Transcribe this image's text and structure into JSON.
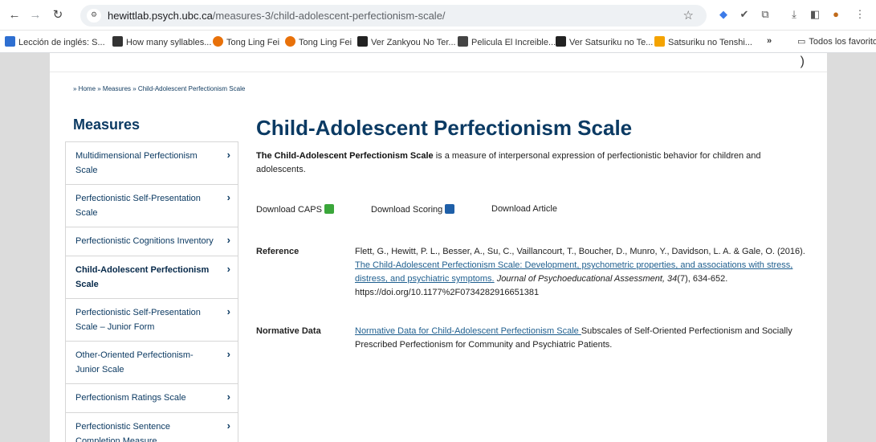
{
  "browser": {
    "url_host": "hewittlab.psych.ubc.ca",
    "url_path": "/measures-3/child-adolescent-perfectionism-scale/",
    "bookmarks": [
      {
        "label": "Lección de inglés: S...",
        "color": "#2e6fd1",
        "icon": "flag-icon"
      },
      {
        "label": "How many syllables...",
        "color": "#333333",
        "icon": "bookmark-icon"
      },
      {
        "label": "Tong Ling Fei",
        "color": "#e8710a",
        "icon": "site-icon"
      },
      {
        "label": "Tong Ling Fei",
        "color": "#e8710a",
        "icon": "site-icon"
      },
      {
        "label": "Ver Zankyou No Ter...",
        "color": "#222222",
        "icon": "af-icon"
      },
      {
        "label": "Pelicula El Increible...",
        "color": "#444444",
        "icon": "site-icon"
      },
      {
        "label": "Ver Satsuriku no Te...",
        "color": "#222222",
        "icon": "af-icon"
      },
      {
        "label": "Satsuriku no Tenshi...",
        "color": "#f4a300",
        "icon": "w-icon"
      }
    ],
    "more_bookmarks": "»",
    "all_bookmarks": "Todos los favoritos"
  },
  "page": {
    "breadcrumb": "» Home » Measures » Child-Adolescent Perfectionism Scale",
    "sidebar": {
      "title": "Measures",
      "items": [
        {
          "label": "Multidimensional Perfectionism Scale",
          "active": false
        },
        {
          "label": "Perfectionistic Self-Presentation Scale",
          "active": false
        },
        {
          "label": "Perfectionistic Cognitions Inventory",
          "active": false
        },
        {
          "label": "Child-Adolescent Perfectionism Scale",
          "active": true
        },
        {
          "label": "Perfectionistic Self-Presentation Scale – Junior Form",
          "active": false
        },
        {
          "label": "Other-Oriented Perfectionism- Junior Scale",
          "active": false
        },
        {
          "label": "Perfectionism Ratings Scale",
          "active": false
        },
        {
          "label": "Perfectionistic Sentence Completion Measure",
          "active": false
        }
      ]
    },
    "title": "Child-Adolescent Perfectionism Scale",
    "intro_bold": "The Child-Adolescent Perfectionism Scale",
    "intro_rest": " is a measure of interpersonal expression of perfectionistic behavior for children and adolescents.",
    "downloads": {
      "caps": "Download CAPS",
      "scoring": "Download Scoring",
      "article": "Download Article"
    },
    "reference": {
      "label": "Reference",
      "authors": "Flett, G., Hewitt, P. L., Besser, A., Su, C., Vaillancourt, T., Boucher, D., Munro, Y., Davidson, L. A. & Gale, O. (2016).",
      "link": "The Child-Adolescent Perfectionism Scale: Development, psychometric properties, and associations with stress, distress, and psychiatric symptoms.",
      "journal": "Journal of Psychoeducational Assessment, 34",
      "issue": "(7), 634-652.",
      "doi": "https://doi.org/10.1177%2F0734282916651381"
    },
    "normative": {
      "label": "Normative Data",
      "link": "Normative Data for Child-Adolescent Perfectionism Scale ",
      "text": "Subscales of Self-Oriented Perfectionism and Socially Prescribed Perfectionism for Community and Psychiatric Patients."
    }
  }
}
